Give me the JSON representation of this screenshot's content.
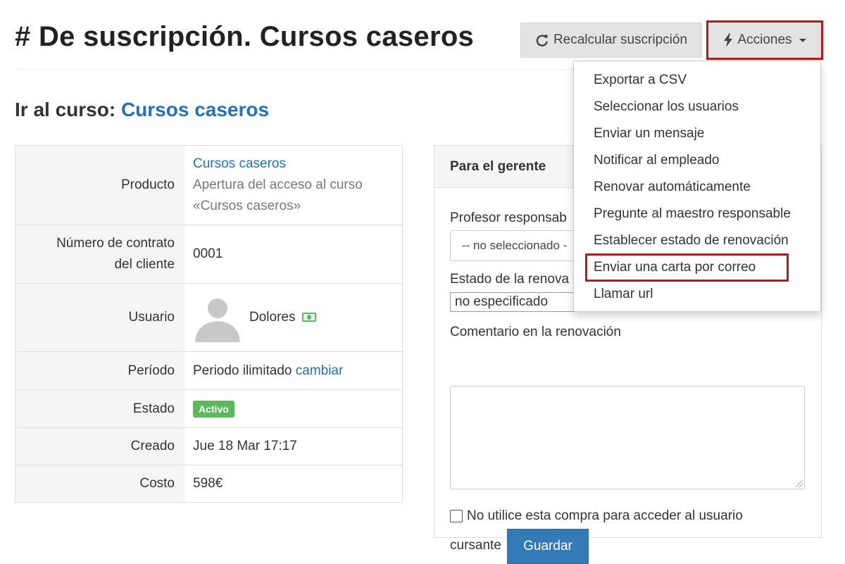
{
  "header": {
    "title": "# De suscripción. Cursos caseros",
    "recalc_label": "Recalcular suscripción",
    "actions_label": "Acciones"
  },
  "actions_menu": {
    "items": [
      {
        "label": "Exportar a CSV"
      },
      {
        "label": "Seleccionar los usuarios"
      },
      {
        "label": "Enviar un mensaje"
      },
      {
        "label": "Notificar al empleado"
      },
      {
        "label": "Renovar automáticamente"
      },
      {
        "label": "Pregunte al maestro responsable"
      },
      {
        "label": "Establecer estado de renovación"
      },
      {
        "label": "Enviar una carta por correo"
      },
      {
        "label": "Llamar url"
      }
    ],
    "highlighted_item": "Enviar una carta por correo"
  },
  "course": {
    "prefix": "Ir al curso:",
    "link_label": "Cursos caseros"
  },
  "details": {
    "product_label": "Producto",
    "product_link": "Cursos caseros",
    "product_desc_1": "Apertura del acceso al curso",
    "product_desc_2": "«Cursos caseros»",
    "contract_label_1": "Número de contrato",
    "contract_label_2": "del cliente",
    "contract_value": "0001",
    "user_label": "Usuario",
    "user_name": "Dolores",
    "period_label": "Período",
    "period_value": "Periodo ilimitado",
    "period_change": "cambiar",
    "status_label": "Estado",
    "status_value": "Activo",
    "created_label": "Creado",
    "created_value": "Jue 18 Mar 17:17",
    "cost_label": "Costo",
    "cost_value": "598€"
  },
  "manager_panel": {
    "title": "Para el gerente",
    "teacher_label": "Profesor responsab",
    "teacher_value": "-- no seleccionado -",
    "renewal_status_label": "Estado de la renova",
    "renewal_status_value": "no especificado",
    "comment_label": "Comentario en la renovación",
    "checkbox_label_1": "No utilice esta compra para acceder al usuario",
    "checkbox_label_2": "cursante",
    "save_label": "Guardar"
  },
  "colors": {
    "accent": "#2270b8",
    "highlight_border": "#b01c1c",
    "status_active": "#5cb85c",
    "primary_button": "#337ab7"
  }
}
